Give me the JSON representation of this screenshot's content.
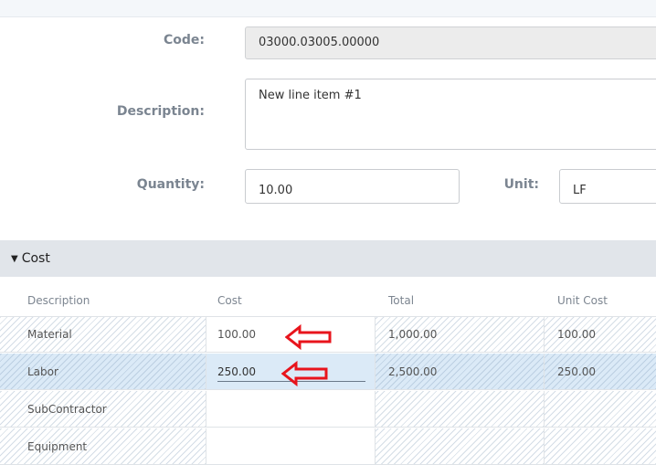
{
  "form": {
    "code_label": "Code:",
    "code_value": "03000.03005.00000",
    "description_label": "Description:",
    "description_value": "New line item #1",
    "quantity_label": "Quantity:",
    "quantity_value": "10.00",
    "unit_label": "Unit:",
    "unit_value": "LF"
  },
  "cost_section": {
    "title": "Cost",
    "headers": [
      "Description",
      "Cost",
      "Total",
      "Unit Cost"
    ],
    "rows": [
      {
        "description": "Material",
        "cost": "100.00",
        "total": "1,000.00",
        "unit_cost": "100.00"
      },
      {
        "description": "Labor",
        "cost": "250.00",
        "total": "2,500.00",
        "unit_cost": "250.00"
      },
      {
        "description": "SubContractor",
        "cost": "",
        "total": "",
        "unit_cost": ""
      },
      {
        "description": "Equipment",
        "cost": "",
        "total": "",
        "unit_cost": ""
      }
    ]
  },
  "colors": {
    "annotation_arrow": "#e8141c",
    "selected_row": "#dbeaf7",
    "section_bar": "#e1e5ea"
  },
  "icons": {
    "collapse": "triangle-down-icon",
    "annotation": "arrow-left-icon"
  }
}
